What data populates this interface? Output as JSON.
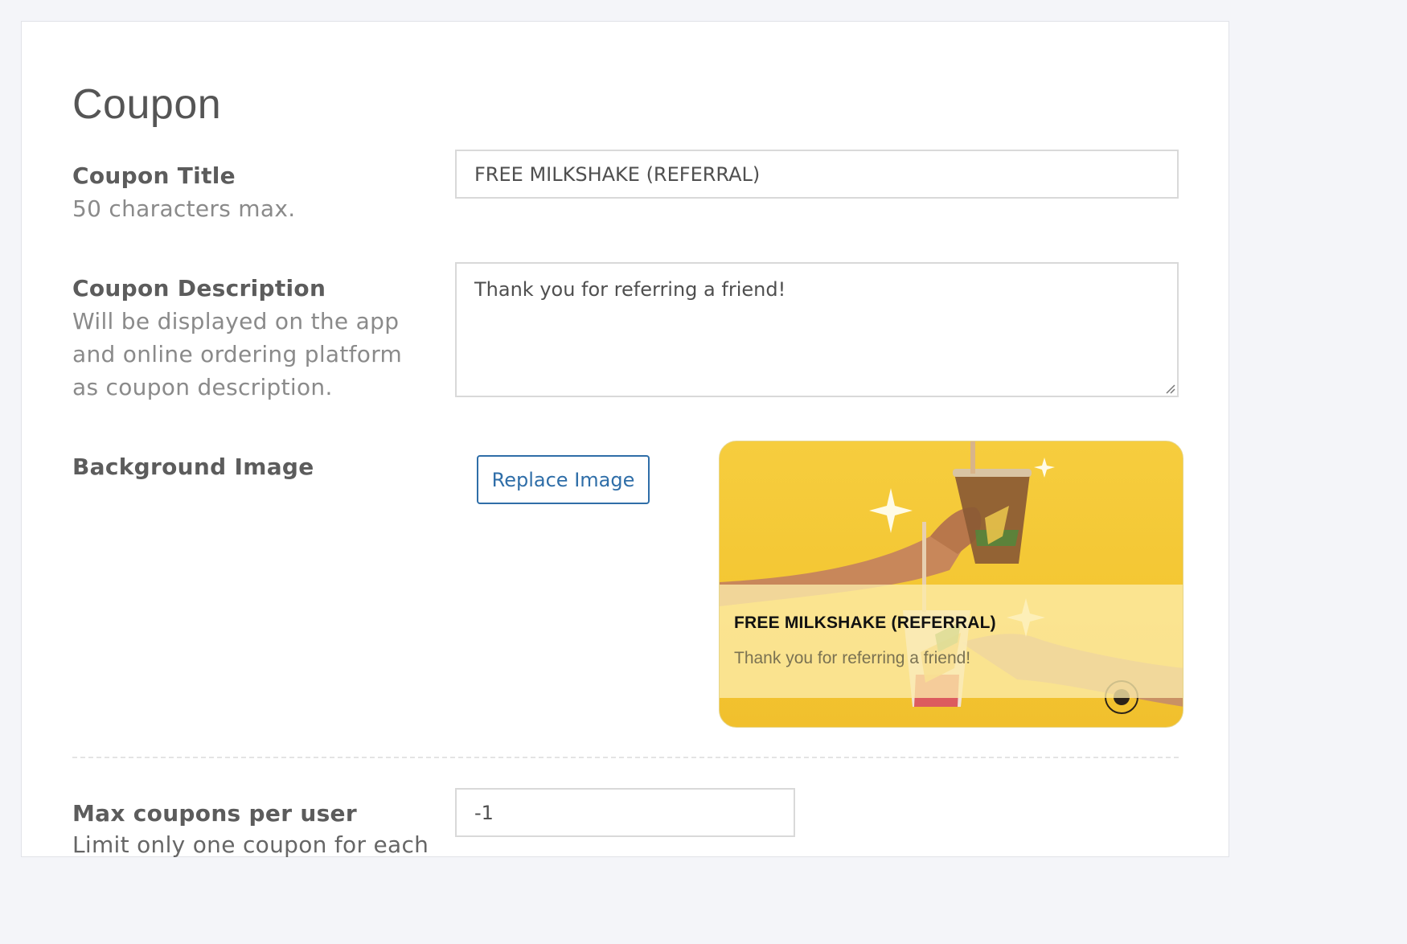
{
  "page": {
    "title": "Coupon"
  },
  "fields": {
    "coupon_title": {
      "label": "Coupon Title",
      "hint": "50 characters max.",
      "value": "FREE MILKSHAKE (REFERRAL)"
    },
    "coupon_description": {
      "label": "Coupon Description",
      "hint_lines": [
        "Will be displayed on the app",
        "and online ordering platform",
        "as coupon description."
      ],
      "value": "Thank you for referring a friend!"
    },
    "background_image": {
      "label": "Background Image",
      "replace_button_label": "Replace Image"
    },
    "max_coupons": {
      "label": "Max coupons per user",
      "hint_partial": "Limit only one coupon for each",
      "value": "-1"
    }
  },
  "preview": {
    "title": "FREE MILKSHAKE (REFERRAL)",
    "description": "Thank you for referring a friend!"
  },
  "colors": {
    "page_bg": "#f4f5f9",
    "card_bg": "#ffffff",
    "accent_blue": "#2f6ea8",
    "coupon_yellow": "#f5c93a"
  }
}
